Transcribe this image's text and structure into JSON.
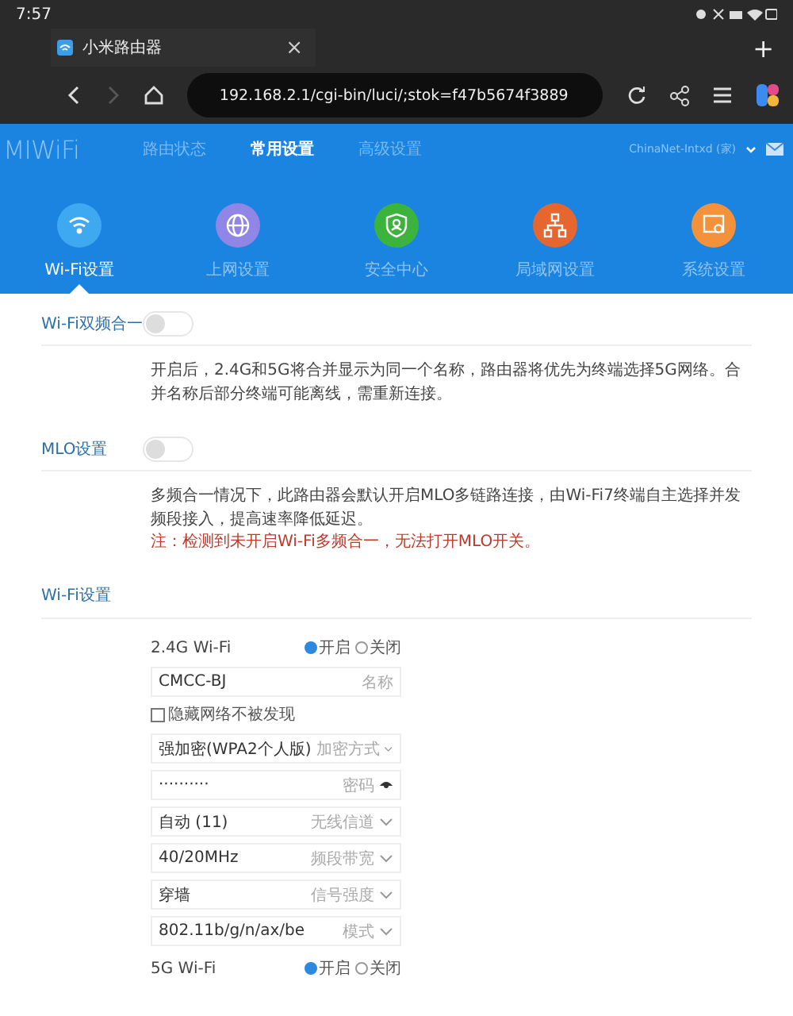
{
  "status_bar": {
    "time": "7:57"
  },
  "browser": {
    "tab": {
      "title": "小米路由器",
      "close": "×"
    },
    "new_tab": "+",
    "url": "192.168.2.1/cgi-bin/luci/;stok=f47b5674f3889"
  },
  "router": {
    "logo": "MIWiFi",
    "nav": [
      {
        "label": "路由状态",
        "selected": false
      },
      {
        "label": "常用设置",
        "selected": true
      },
      {
        "label": "高级设置",
        "selected": false
      }
    ],
    "network": "ChinaNet-Intxd (家)",
    "categories": [
      {
        "label": "Wi-Fi设置",
        "kind": "wifi",
        "color": "#3ea8f0",
        "selected": true
      },
      {
        "label": "上网设置",
        "kind": "globe",
        "color": "#8f86e6",
        "selected": false
      },
      {
        "label": "安全中心",
        "kind": "shield",
        "color": "#3cb33c",
        "selected": false
      },
      {
        "label": "局域网设置",
        "kind": "lan",
        "color": "#e5662f",
        "selected": false
      },
      {
        "label": "系统设置",
        "kind": "system",
        "color": "#f3923a",
        "selected": false
      }
    ]
  },
  "settings": [
    {
      "label": "Wi-Fi双频合一",
      "on": false,
      "description": "开启后，2.4G和5G将合并显示为同一个名称，路由器将优先为终端选择5G网络。合并名称后部分终端可能离线，需重新连接。"
    },
    {
      "label": "MLO设置",
      "on": false,
      "description": "多频合一情况下，此路由器会默认开启MLO多链路连接，由Wi-Fi7终端自主选择并发频段接入，提高速率降低延迟。",
      "note": "注：检测到未开启Wi-Fi多频合一，无法打开MLO开关。"
    }
  ],
  "wifi_section": {
    "title": "Wi-Fi设置",
    "bands": [
      {
        "name": "2.4G Wi-Fi",
        "options": [
          {
            "label": "开启",
            "selected": true
          },
          {
            "label": "关闭",
            "selected": false
          }
        ],
        "fields": [
          {
            "kind": "text",
            "value": "CMCC-BJ",
            "label": "名称"
          },
          {
            "kind": "checkbox",
            "caption": "隐藏网络不被发现",
            "checked": false
          },
          {
            "kind": "select",
            "value": "强加密(WPA2个人版)",
            "label": "加密方式"
          },
          {
            "kind": "password",
            "value": "··········",
            "label": "密码"
          },
          {
            "kind": "select",
            "value": "自动 (11)",
            "label": "无线信道"
          },
          {
            "kind": "select",
            "value": "40/20MHz",
            "label": "频段带宽"
          },
          {
            "kind": "select",
            "value": "穿墙",
            "label": "信号强度"
          },
          {
            "kind": "select",
            "value": "802.11b/g/n/ax/be",
            "label": "模式"
          }
        ]
      },
      {
        "name": "5G Wi-Fi",
        "options": [
          {
            "label": "开启",
            "selected": true
          },
          {
            "label": "关闭",
            "selected": false
          }
        ]
      }
    ]
  }
}
